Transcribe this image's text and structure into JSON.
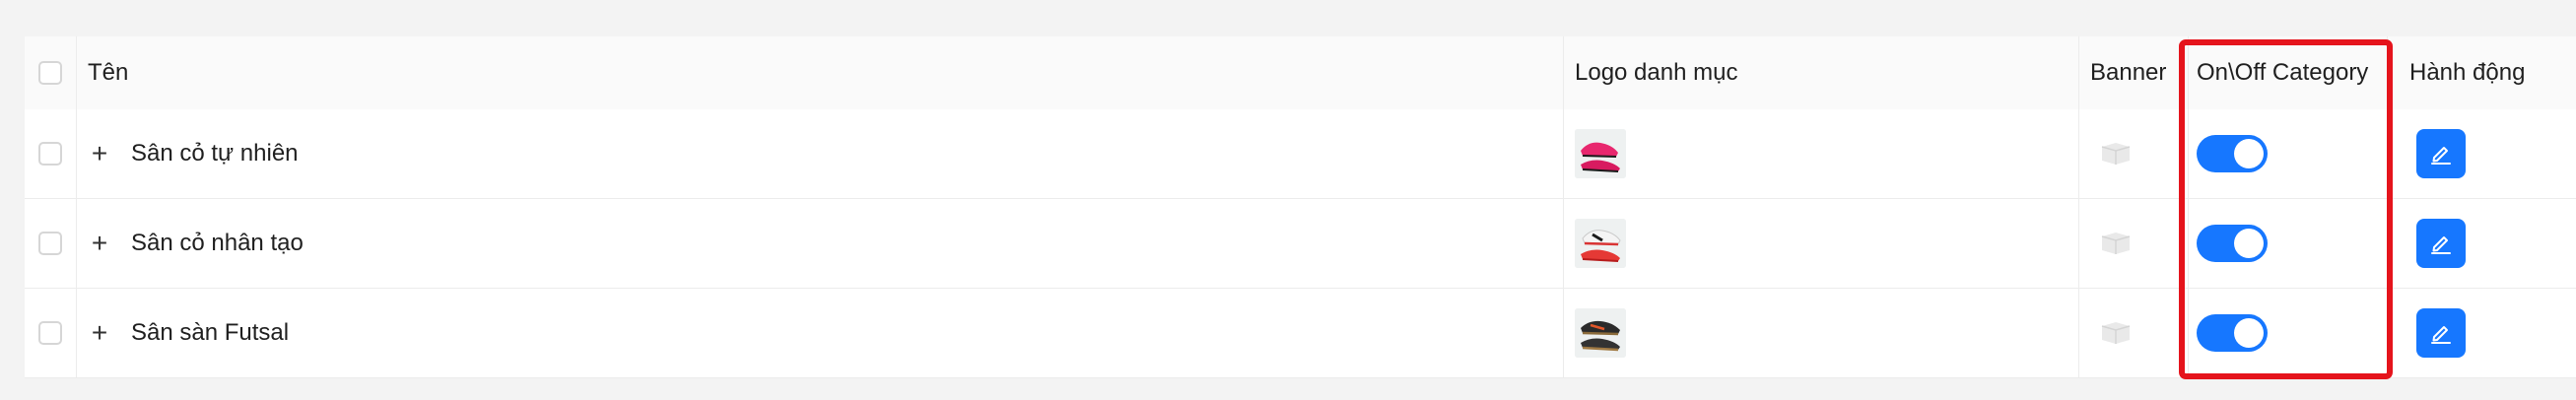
{
  "table": {
    "columns": {
      "name": "Tên",
      "logo": "Logo danh mục",
      "banner": "Banner",
      "status": "On\\Off Category",
      "actions": "Hành động"
    },
    "rows": [
      {
        "name": "Sân cỏ tự nhiên",
        "enabled": true,
        "logo_icon": "pink-soccer-cleats-image",
        "banner_icon": "placeholder-image-icon"
      },
      {
        "name": "Sân cỏ nhân tạo",
        "enabled": true,
        "logo_icon": "white-red-soccer-cleats-image",
        "banner_icon": "placeholder-image-icon"
      },
      {
        "name": "Sân sàn Futsal",
        "enabled": true,
        "logo_icon": "dark-futsal-shoes-image",
        "banner_icon": "placeholder-image-icon"
      }
    ]
  },
  "colors": {
    "accent": "#1677ff",
    "highlight": "#e5141c"
  }
}
